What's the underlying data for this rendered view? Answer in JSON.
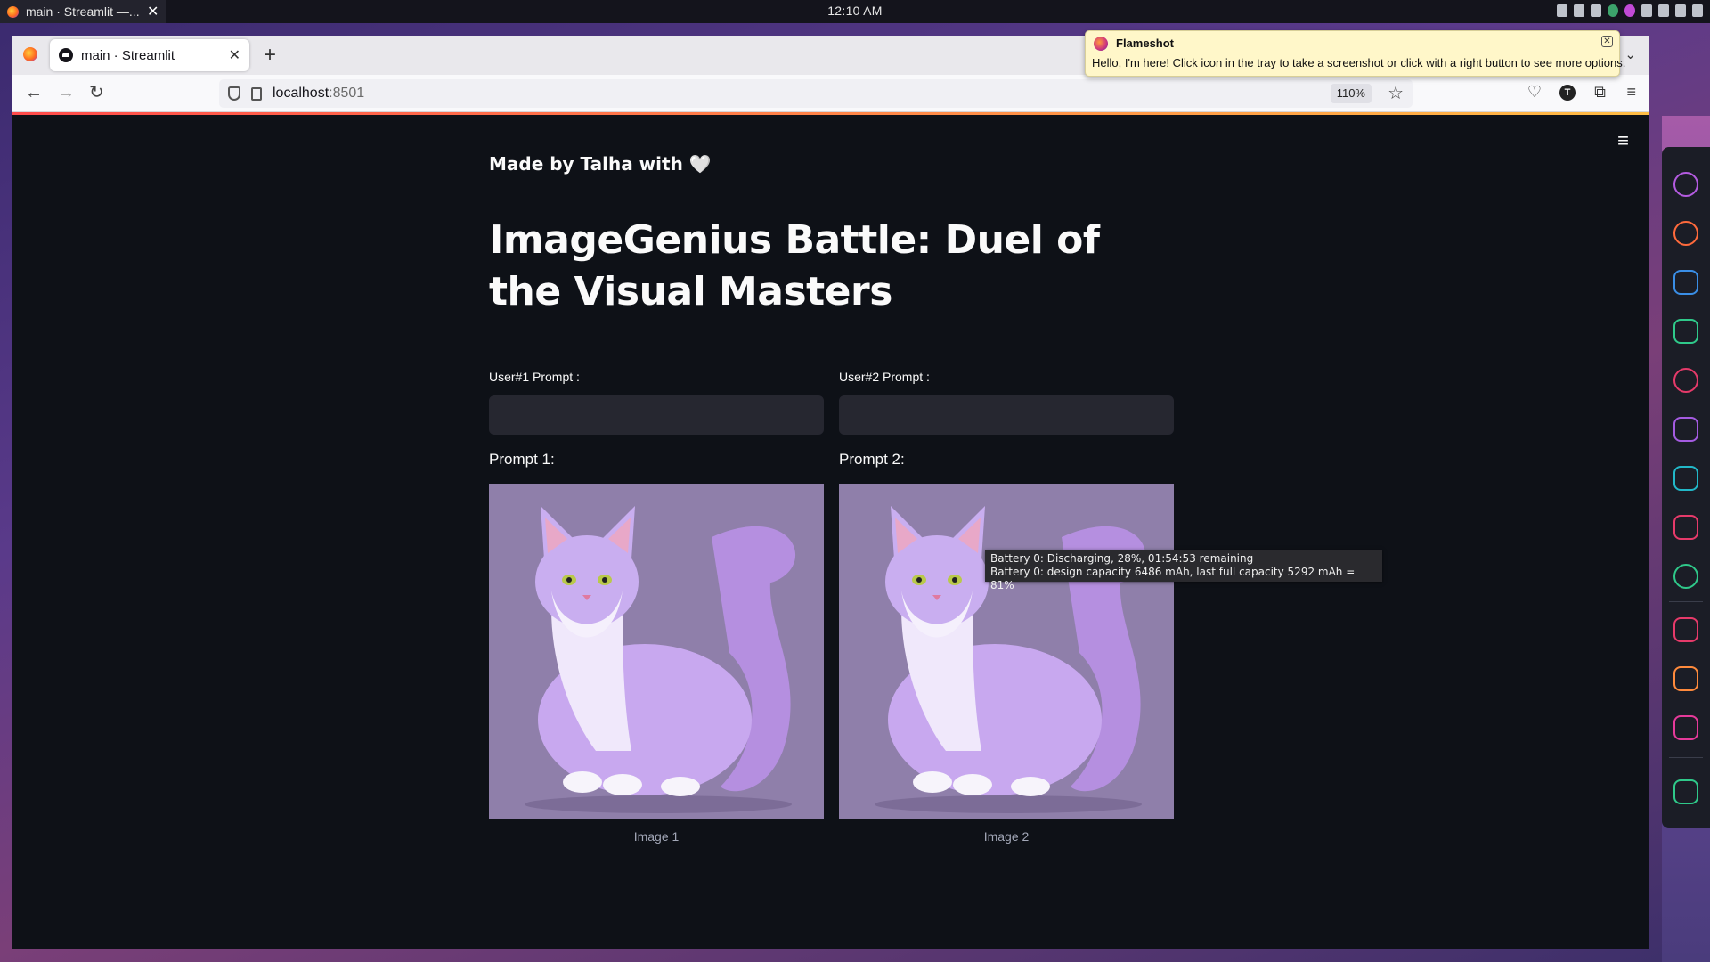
{
  "desktop": {
    "window_title": "main · Streamlit —...",
    "clock": "12:10 AM"
  },
  "browser": {
    "tab_title": "main · Streamlit",
    "url_host": "localhost",
    "url_port": ":8501",
    "zoom": "110%"
  },
  "notification": {
    "app": "Flameshot",
    "message": "Hello, I'm here! Click icon in the tray to take a screenshot or click with a right button to see more options."
  },
  "tooltip": {
    "line1": "Battery 0: Discharging, 28%, 01:54:53 remaining",
    "line2": "Battery 0: design capacity 6486 mAh, last full capacity 5292 mAh = 81%"
  },
  "app": {
    "credit": "Made by Talha with 🤍",
    "title": "ImageGenius Battle: Duel of the Visual Masters",
    "user1_label": "User#1 Prompt :",
    "user2_label": "User#2 Prompt :",
    "user1_value": "",
    "user2_value": "",
    "prompt1_text": "Prompt 1:",
    "prompt2_text": "Prompt 2:",
    "image1_caption": "Image 1",
    "image2_caption": "Image 2"
  },
  "colors": {
    "background": "#0e1117",
    "input_bg": "#262730",
    "accent": "#ff4b4b"
  }
}
